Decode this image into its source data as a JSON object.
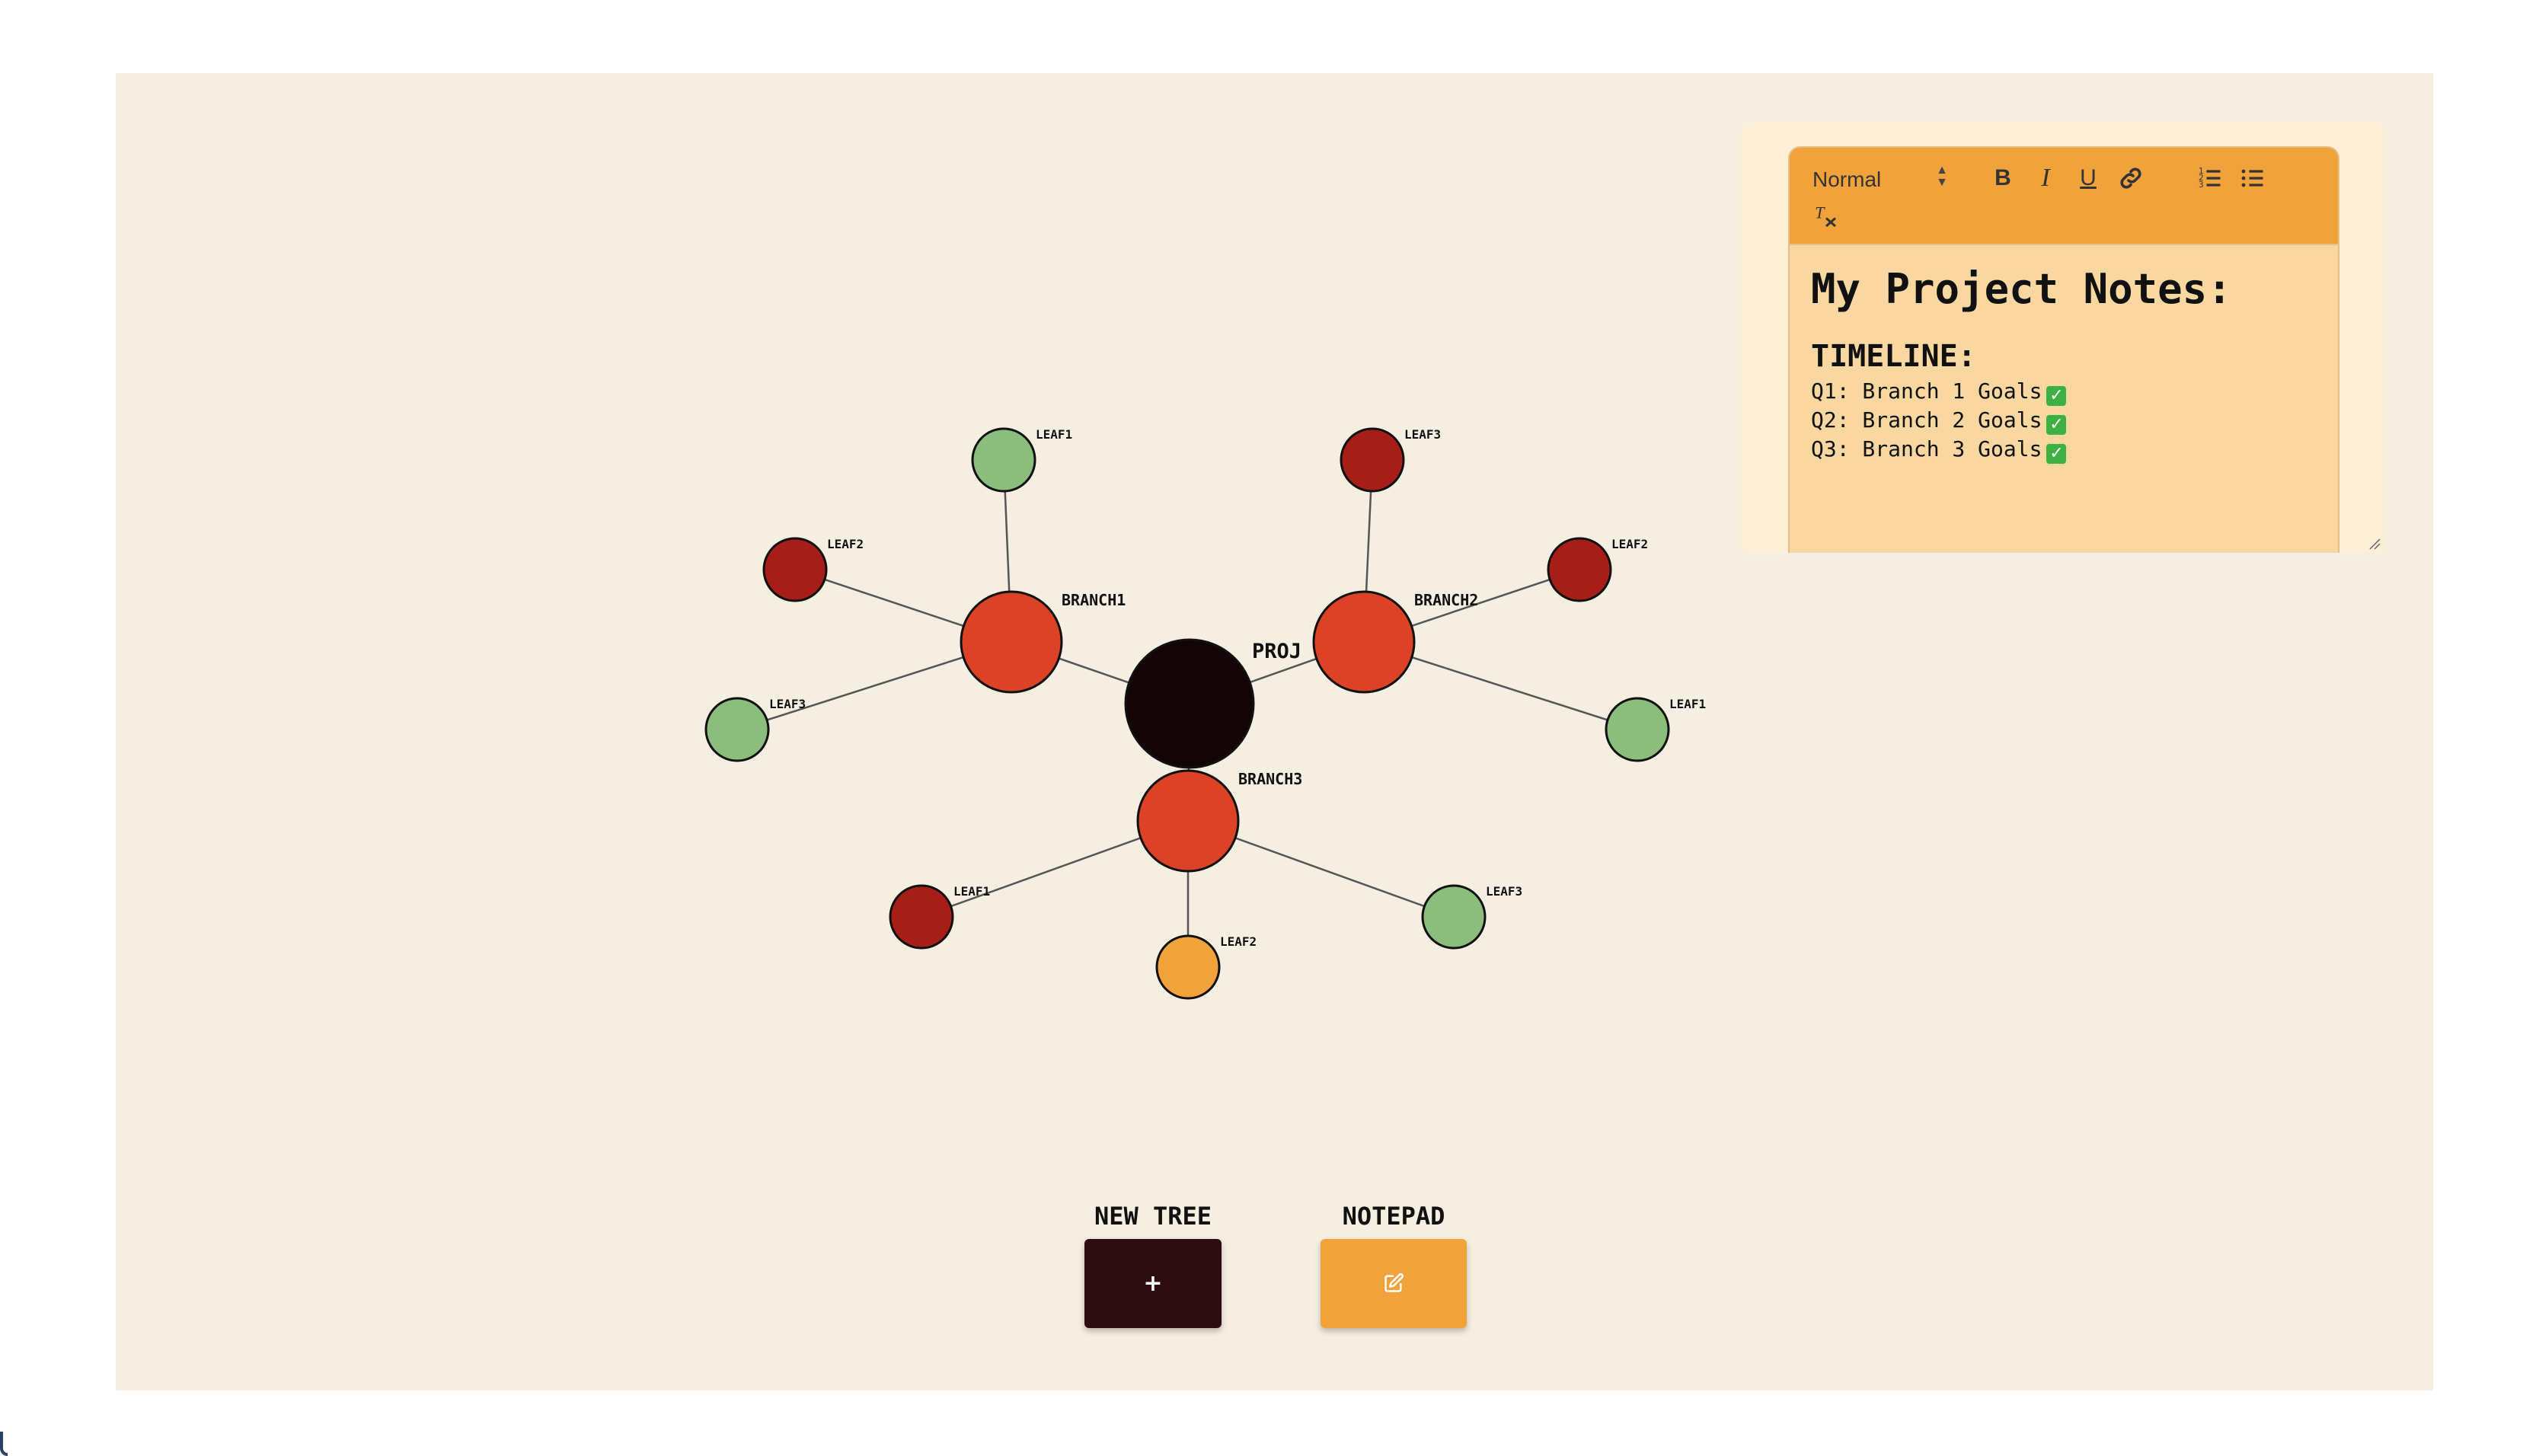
{
  "tree": {
    "root": {
      "label": "PROJ",
      "color": "#140405"
    },
    "branch_color": "#dc4225",
    "colors": {
      "green": "#8bbd7d",
      "red": "#a51e17",
      "orange": "#f1a23a"
    },
    "branches": [
      {
        "label": "BRANCH1",
        "leaves": [
          {
            "label": "LEAF1",
            "color": "green"
          },
          {
            "label": "LEAF2",
            "color": "red"
          },
          {
            "label": "LEAF3",
            "color": "green"
          }
        ]
      },
      {
        "label": "BRANCH2",
        "leaves": [
          {
            "label": "LEAF3",
            "color": "red"
          },
          {
            "label": "LEAF2",
            "color": "red"
          },
          {
            "label": "LEAF1",
            "color": "green"
          }
        ]
      },
      {
        "label": "BRANCH3",
        "leaves": [
          {
            "label": "LEAF1",
            "color": "red"
          },
          {
            "label": "LEAF2",
            "color": "orange"
          },
          {
            "label": "LEAF3",
            "color": "green"
          }
        ]
      }
    ]
  },
  "notepad": {
    "toolbar": {
      "format_select": "Normal",
      "bold": "B",
      "italic": "I",
      "underline": "U",
      "icons": [
        "link-icon",
        "ordered-list-icon",
        "bullet-list-icon",
        "clear-format-icon"
      ]
    },
    "title": "My Project Notes:",
    "subtitle": "TIMELINE:",
    "lines": [
      "Q1: Branch 1 Goals",
      "Q2: Branch 2 Goals",
      "Q3: Branch 3 Goals"
    ],
    "check_icon": "check-mark-emoji"
  },
  "controls": {
    "new_tree_label": "NEW TREE",
    "new_tree_button": "+",
    "notepad_label": "NOTEPAD",
    "notepad_icon": "edit-icon"
  }
}
